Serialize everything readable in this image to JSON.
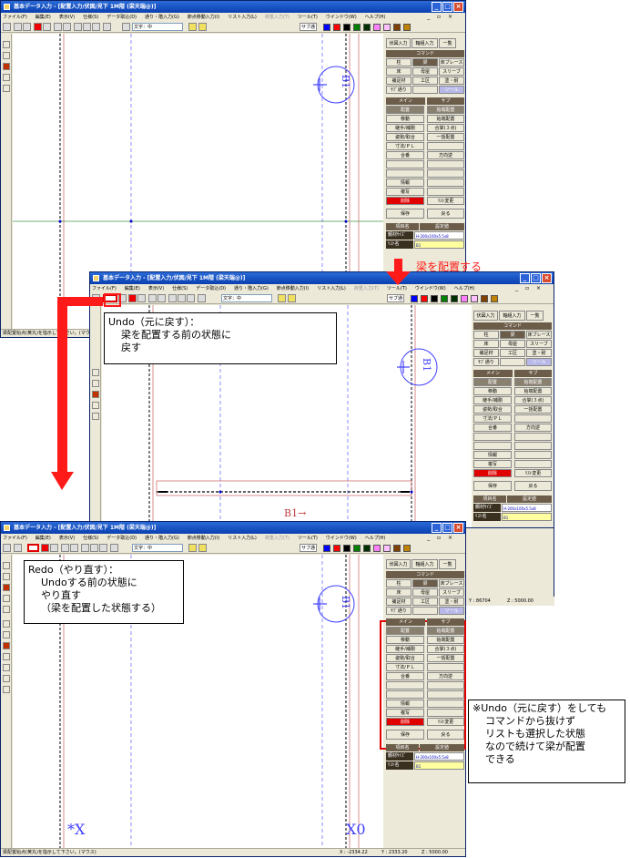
{
  "app": {
    "title": "基本データ入力 - [配置入力/伏図/見下 1M階 (梁天端@)]",
    "menu": [
      "ファイル(F)",
      "編集(E)",
      "表示(V)",
      "仕様(S)",
      "データ取込(D)",
      "通り・階入力(G)",
      "節点移動入力(I)",
      "リスト入力(L)",
      "荷重入力(T)",
      "ツール(T)",
      "ウインドウ(W)",
      "ヘルプ(H)"
    ],
    "font_label": "文字：中",
    "sub_label": "サブ通",
    "colors": [
      "#0000ff",
      "#ff0000",
      "#000000",
      "#008000",
      "#003000",
      "#ff80ff",
      "#ffc0ff",
      "#804000",
      "#c08000"
    ]
  },
  "panel": {
    "tabs": [
      "伏図入力",
      "軸組入力",
      "一覧"
    ],
    "command_header": "コマンド",
    "commands": [
      "柱",
      "梁",
      "床ブレース",
      "床",
      "母屋",
      "スリーブ",
      "補足材",
      "工区",
      "塗・耐",
      "ｻﾌﾞ通り",
      "",
      "ツール"
    ],
    "main_header": "メイン",
    "sub_header": "サブ",
    "main_items": [
      "配置",
      "移動",
      "継手/補剛",
      "姿勢/取合",
      "寸法/ＰＬ",
      "合番",
      "",
      "",
      "情報",
      "複写",
      "削除"
    ],
    "sub_items": [
      "始端配置",
      "始端配置",
      "合掌(３点)",
      "一括配置",
      "",
      "方向逆",
      "",
      "",
      "",
      "",
      "ﾘｽﾄ変更"
    ],
    "save": "保存",
    "back": "戻る",
    "grid_h1": "項目名",
    "grid_h2": "設定値",
    "row1_name": "鋼材ｻｲｽﾞ",
    "row1_value": "H-200x100x5.5x8",
    "row2_name": "ﾘｽﾄ名",
    "row2_value": "B1"
  },
  "drawing": {
    "b1_label": "B1",
    "b1_arrow_label": "B1→",
    "axis_x": "*X",
    "axis_x0": "X0"
  },
  "status": {
    "message": "梁配置始点(黄丸)を指示して下さい。(マウス)",
    "x": "X : -2334.22",
    "y": "Y : 2333.20",
    "z": "Z : 5000.00",
    "partial_y": "Y : 86704",
    "partial_z": "Z : 5000.00"
  },
  "annotations": {
    "place_beam": "梁を配置する",
    "undo_title": "Undo（元に戻す）：",
    "undo_l2": "梁を配置する前の状態に",
    "undo_l3": "戻す",
    "redo_title": "Redo（やり直す）：",
    "redo_l2": "Undoする前の状態に",
    "redo_l3": "やり直す",
    "redo_l4": "（梁を配置した状態する）",
    "note_l1": "※Undo（元に戻す）をしても",
    "note_l2": "コマンドから抜けず",
    "note_l3": "リストも選択した状態",
    "note_l4": "なので続けて梁が配置",
    "note_l5": "できる"
  }
}
